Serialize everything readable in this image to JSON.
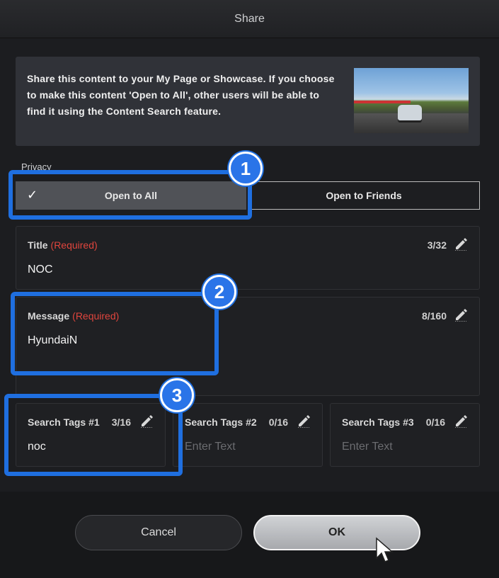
{
  "window": {
    "title": "Share"
  },
  "intro": {
    "text": "Share this content to your My Page or Showcase. If you choose to make this content 'Open to All', other users will be able to find it using the Content Search feature."
  },
  "privacy": {
    "label": "Privacy",
    "options": [
      {
        "label": "Open to All",
        "selected": true
      },
      {
        "label": "Open to Friends",
        "selected": false
      }
    ]
  },
  "title_field": {
    "label": "Title",
    "required": "(Required)",
    "count": "3/32",
    "value": "NOC"
  },
  "message_field": {
    "label": "Message",
    "required": "(Required)",
    "count": "8/160",
    "value": "HyundaiN"
  },
  "tags": [
    {
      "label": "Search Tags #1",
      "count": "3/16",
      "value": "noc"
    },
    {
      "label": "Search Tags #2",
      "count": "0/16",
      "placeholder": "Enter Text"
    },
    {
      "label": "Search Tags #3",
      "count": "0/16",
      "placeholder": "Enter Text"
    }
  ],
  "buttons": {
    "cancel": "Cancel",
    "ok": "OK"
  },
  "annotations": [
    "1",
    "2",
    "3"
  ],
  "colors": {
    "highlight": "#1f6fe0",
    "required": "#e0453d"
  }
}
